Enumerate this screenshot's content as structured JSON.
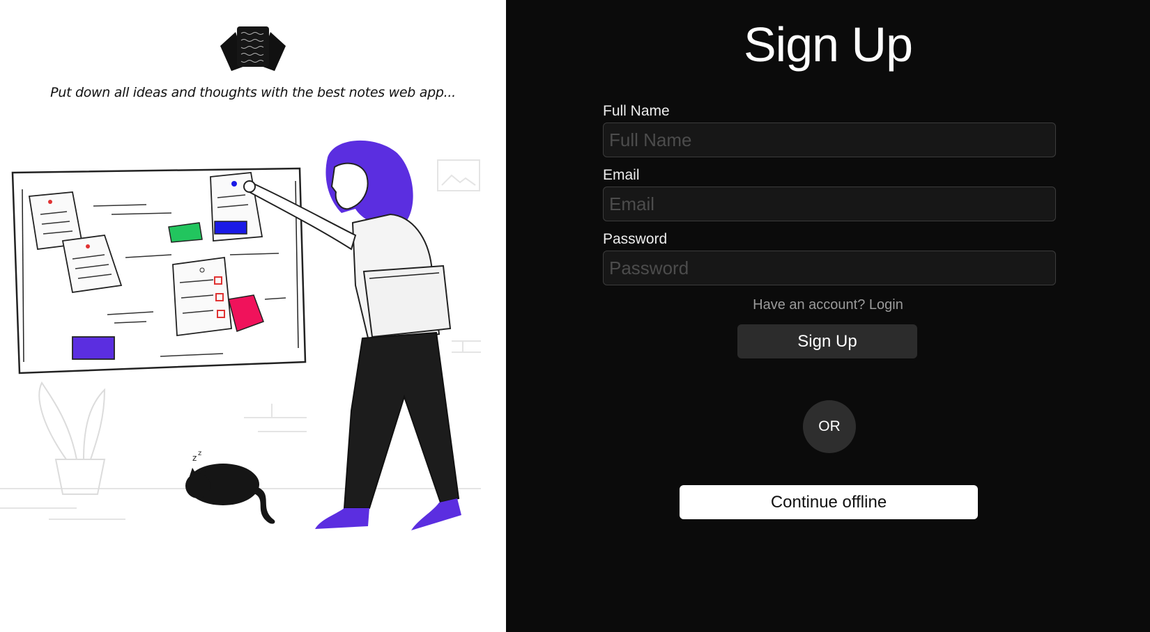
{
  "hero": {
    "tagline": "Put down all ideas and thoughts with the best notes web app..."
  },
  "signup": {
    "title": "Sign Up",
    "fields": [
      {
        "label": "Full Name",
        "placeholder": "Full Name",
        "value": ""
      },
      {
        "label": "Email",
        "placeholder": "Email",
        "value": ""
      },
      {
        "label": "Password",
        "placeholder": "Password",
        "value": ""
      }
    ],
    "have_account_text": "Have an account?",
    "login_link": "Login",
    "submit_label": "Sign Up",
    "or_label": "OR",
    "offline_label": "Continue offline"
  },
  "colors": {
    "accent_purple": "#5b2ee0",
    "note_blue": "#1a1ae6",
    "note_green": "#22c55e",
    "note_pink": "#f0125b",
    "panel_dark": "#0b0b0b"
  }
}
